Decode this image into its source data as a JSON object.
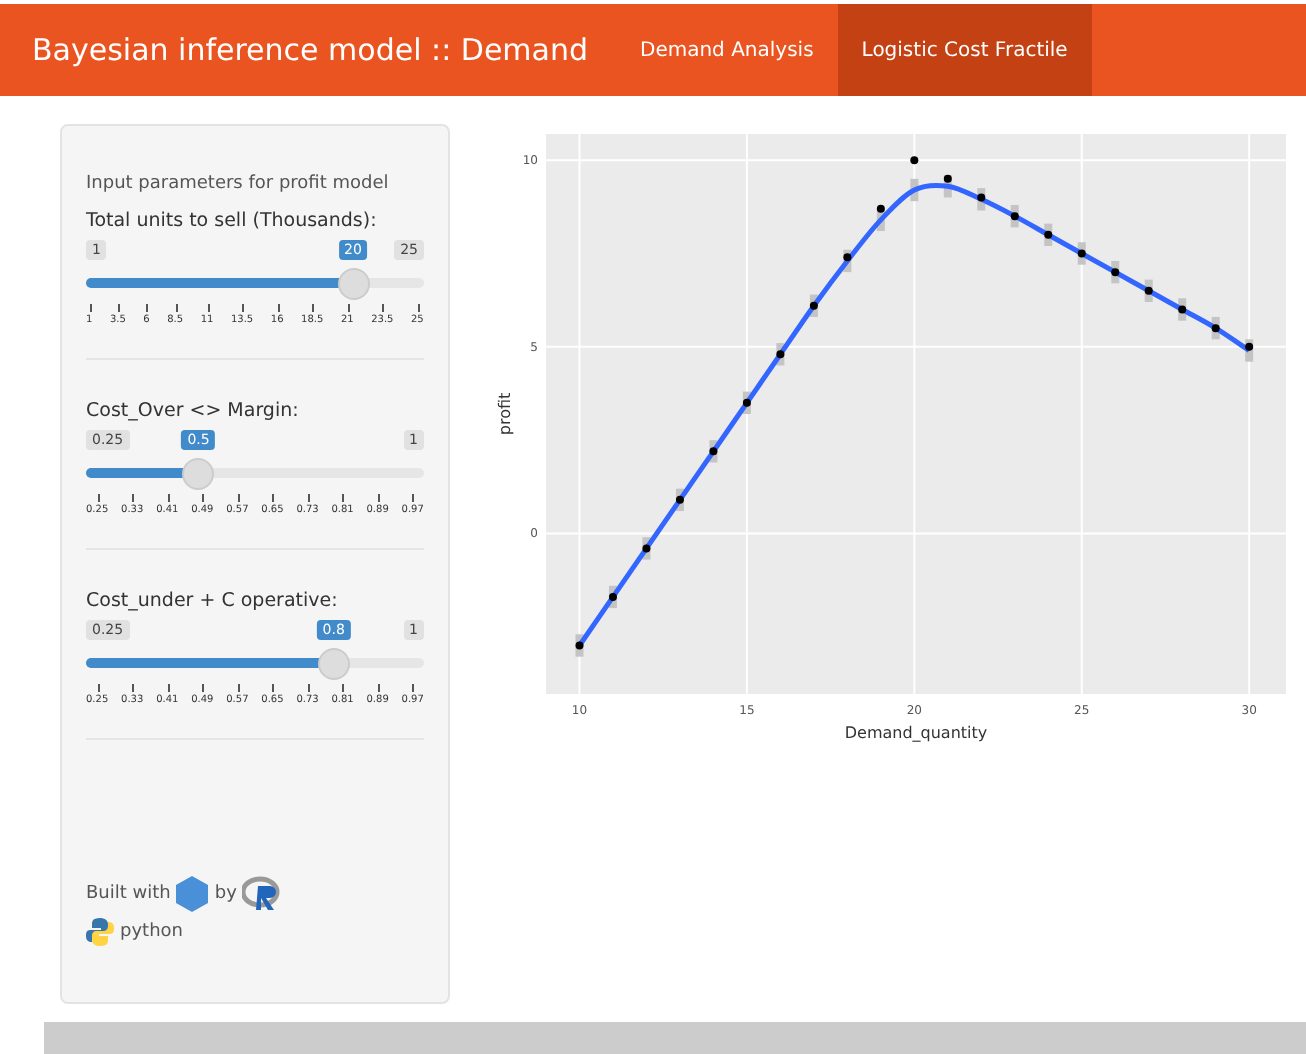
{
  "navbar": {
    "title": "Bayesian inference model :: Demand",
    "tabs": [
      {
        "label": "Demand Analysis",
        "selected": false
      },
      {
        "label": "Logistic Cost Fractile",
        "selected": true
      }
    ]
  },
  "sidebar": {
    "heading": "Input parameters for profit model",
    "sliders": [
      {
        "label": "Total units to sell (Thousands):",
        "min": "1",
        "max": "25",
        "value": "20",
        "level": 0.79,
        "ticks": [
          "1",
          "3.5",
          "6",
          "8.5",
          "11",
          "13.5",
          "16",
          "18.5",
          "21",
          "23.5",
          "25"
        ]
      },
      {
        "label": "Cost_Over <> Margin:",
        "min": "0.25",
        "max": "1",
        "value": "0.5",
        "level": 0.333,
        "ticks": [
          "0.25",
          "0.33",
          "0.41",
          "0.49",
          "0.57",
          "0.65",
          "0.73",
          "0.81",
          "0.89",
          "0.97"
        ]
      },
      {
        "label": "Cost_under + C operative:",
        "min": "0.25",
        "max": "1",
        "value": "0.8",
        "level": 0.733,
        "ticks": [
          "0.25",
          "0.33",
          "0.41",
          "0.49",
          "0.57",
          "0.65",
          "0.73",
          "0.81",
          "0.89",
          "0.97"
        ]
      }
    ],
    "footer": {
      "built_with": "Built with",
      "by": "by",
      "python": "python"
    }
  },
  "chart_data": {
    "type": "scatter",
    "xlabel": "Demand_quantity",
    "ylabel": "profit",
    "x": [
      10,
      11,
      12,
      13,
      14,
      15,
      16,
      17,
      18,
      19,
      20,
      21,
      22,
      23,
      24,
      25,
      26,
      27,
      28,
      29,
      30
    ],
    "series": [
      {
        "type": "scatter",
        "color": "#000000",
        "values": [
          -3.0,
          -1.7,
          -0.4,
          0.9,
          2.2,
          3.5,
          4.8,
          6.1,
          7.4,
          8.7,
          10.0,
          9.5,
          9.0,
          8.5,
          8.0,
          7.5,
          7.0,
          6.5,
          6.0,
          5.5,
          5.0
        ]
      },
      {
        "type": "line",
        "color": "#3366ff",
        "values": [
          -3.0,
          -1.7,
          -0.4,
          0.9,
          2.2,
          3.5,
          4.8,
          6.1,
          7.3,
          8.4,
          9.2,
          9.3,
          8.95,
          8.5,
          8.0,
          7.5,
          7.0,
          6.5,
          6.0,
          5.5,
          4.9
        ],
        "errors": [
          0.3,
          0.3,
          0.3,
          0.3,
          0.3,
          0.3,
          0.3,
          0.3,
          0.3,
          0.3,
          0.3,
          0.3,
          0.3,
          0.3,
          0.3,
          0.3,
          0.3,
          0.3,
          0.3,
          0.3,
          0.3
        ]
      }
    ],
    "xlim": [
      9,
      31.1
    ],
    "ylim": [
      -4.3,
      10.7
    ],
    "xticks": [
      10,
      15,
      20,
      25,
      30
    ],
    "yticks": [
      0,
      5,
      10
    ],
    "grid": true
  }
}
